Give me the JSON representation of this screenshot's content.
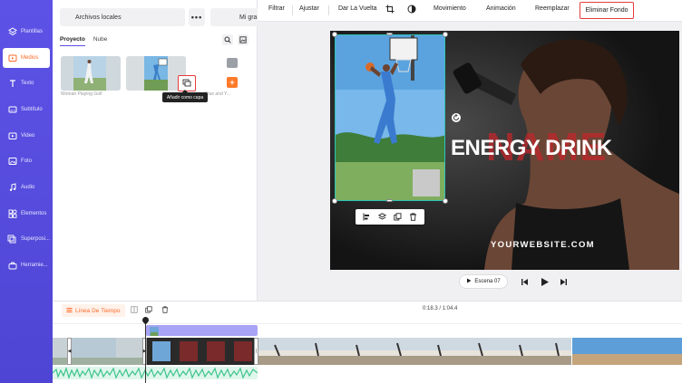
{
  "nav": {
    "items": [
      {
        "label": "Plantillas",
        "icon": "layers-icon"
      },
      {
        "label": "Medios",
        "icon": "folder-icon",
        "active": true
      },
      {
        "label": "Texto",
        "icon": "text-icon"
      },
      {
        "label": "Subtítulo",
        "icon": "subtitle-icon"
      },
      {
        "label": "Video",
        "icon": "video-icon"
      },
      {
        "label": "Foto",
        "icon": "photo-icon"
      },
      {
        "label": "Audio",
        "icon": "music-icon"
      },
      {
        "label": "Elementos",
        "icon": "elements-icon"
      },
      {
        "label": "Superposi...",
        "icon": "overlay-icon"
      },
      {
        "label": "Herramie...",
        "icon": "toolbox-icon"
      }
    ]
  },
  "panel": {
    "local_files": "Archivos locales",
    "more": "•••",
    "recording": "Mi grabación",
    "tabs": [
      "Proyecto",
      "Nube"
    ],
    "thumbs": [
      {
        "label": "Woman Playing Golf"
      },
      {
        "label": "Blue and Y..."
      }
    ],
    "tooltip": "Añadir como capa"
  },
  "toolbar": {
    "items": [
      "Filtrar",
      "Ajustar",
      "Dar La Vuelta",
      "Movimiento",
      "Animación",
      "Reemplazar"
    ],
    "remove_bg": "Eliminar Fondo"
  },
  "canvas": {
    "headline": "ENERGY DRINK",
    "ghost": "NAME",
    "website": "YOURWEBSITE.COM"
  },
  "playback": {
    "scene": "Escena 07"
  },
  "timeline": {
    "label": "Línea De Tiempo",
    "timecode": "0:18.3 / 1:04.4"
  },
  "colors": {
    "nav_bg": "#5a4fe0",
    "accent_orange": "#ff6a2a",
    "highlight_red": "#e63b3b",
    "selection_teal": "#2fc3b8"
  }
}
